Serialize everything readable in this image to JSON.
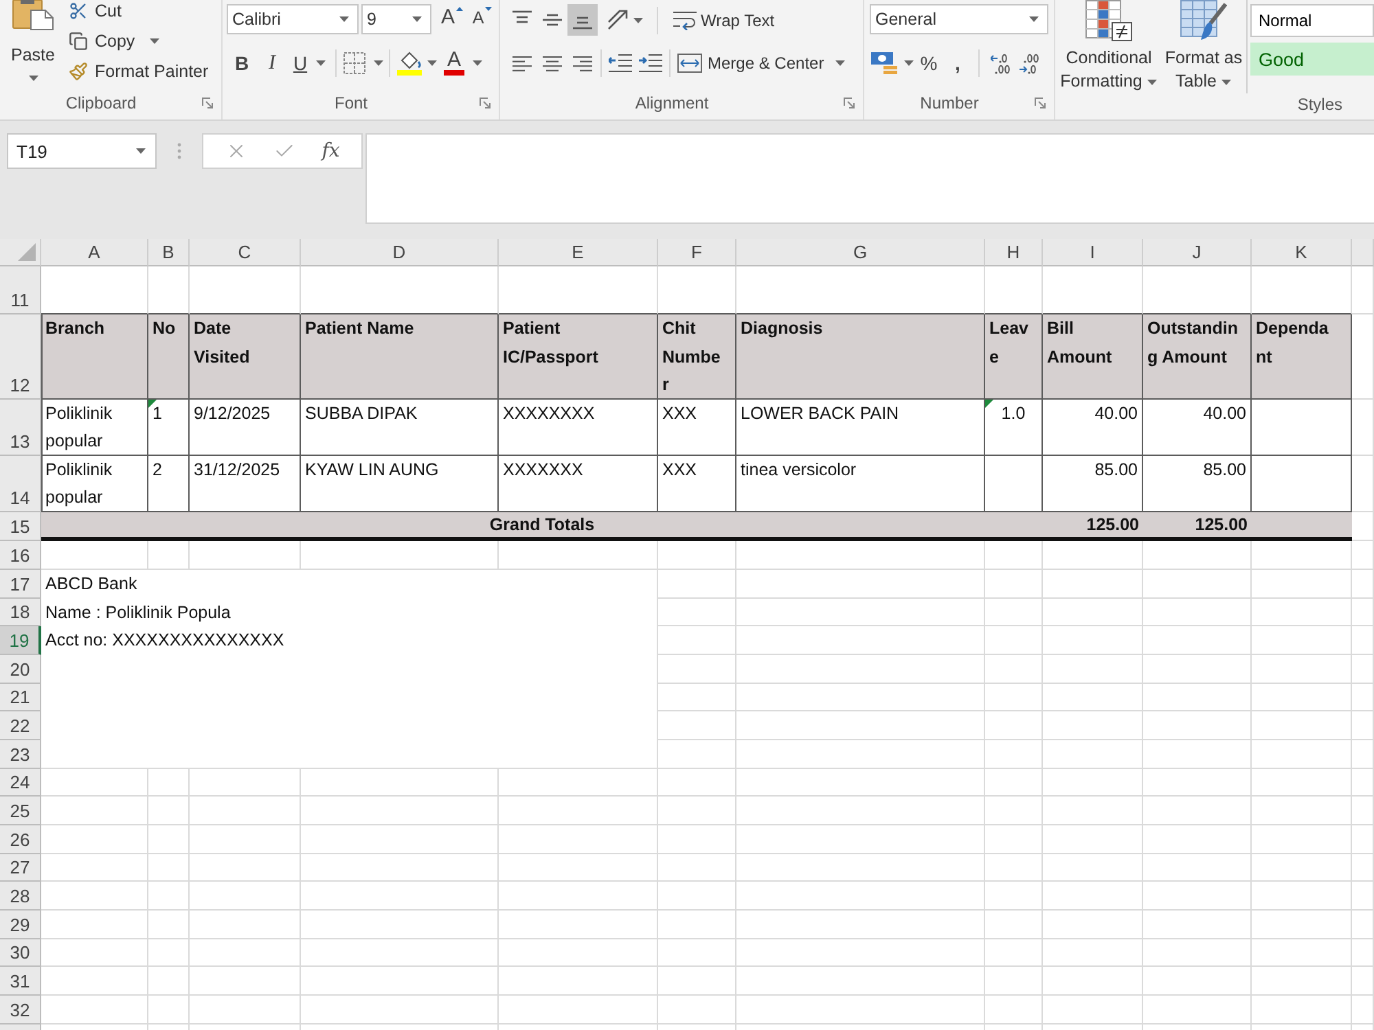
{
  "ribbon": {
    "clipboard": {
      "paste": "Paste",
      "cut": "Cut",
      "copy": "Copy",
      "format_painter": "Format Painter",
      "label": "Clipboard"
    },
    "font": {
      "font_name": "Calibri",
      "font_size": "9",
      "grow_font": "A",
      "shrink_font": "A",
      "bold": "B",
      "italic": "I",
      "underline": "U",
      "font_color": "A",
      "label": "Font"
    },
    "alignment": {
      "vertical_align": [
        {
          "kind": "top",
          "selected": false
        },
        {
          "kind": "middle",
          "selected": false
        },
        {
          "kind": "bottom",
          "selected": true
        }
      ],
      "horizontal_align": [
        {
          "kind": "left",
          "selected": false
        },
        {
          "kind": "center",
          "selected": false
        },
        {
          "kind": "right",
          "selected": false
        }
      ],
      "wrap_text": "Wrap Text",
      "merge_center": "Merge & Center",
      "label": "Alignment"
    },
    "number": {
      "format": "General",
      "percent": "%",
      "comma": ",",
      "label": "Number"
    },
    "styles": {
      "conditional_formatting": [
        "Conditional",
        "Formatting"
      ],
      "format_as_table": [
        "Format as",
        "Table"
      ],
      "cell_styles": [
        {
          "label": "Normal",
          "kind": "normal"
        },
        {
          "label": "Good",
          "kind": "good"
        }
      ],
      "label": "Styles"
    }
  },
  "formula_bar": {
    "name_box": "T19",
    "insert_function": "fx"
  },
  "sheet": {
    "columns": [
      "A",
      "B",
      "C",
      "D",
      "E",
      "F",
      "G",
      "H",
      "I",
      "J",
      "K"
    ],
    "rows": [
      {
        "label": "11",
        "selected": false,
        "kind": "blank"
      },
      {
        "label": "12",
        "selected": false,
        "kind": "header",
        "cells": [
          {
            "lines": [
              "Branch"
            ]
          },
          {
            "lines": [
              "No"
            ]
          },
          {
            "lines": [
              "Date",
              "Visited"
            ]
          },
          {
            "lines": [
              "Patient Name"
            ]
          },
          {
            "lines": [
              "Patient",
              "IC/Passport"
            ]
          },
          {
            "lines": [
              "Chit",
              "Numbe",
              "r"
            ]
          },
          {
            "lines": [
              "Diagnosis"
            ]
          },
          {
            "lines": [
              "Leav",
              "e"
            ]
          },
          {
            "lines": [
              "Bill",
              "Amount"
            ]
          },
          {
            "lines": [
              "Outstandin",
              "g Amount"
            ]
          },
          {
            "lines": [
              "Dependa",
              "nt"
            ]
          }
        ]
      },
      {
        "label": "13",
        "selected": false,
        "kind": "data",
        "cells": [
          {
            "text": "Poliklinik popular",
            "flag": false
          },
          {
            "text": "1",
            "flag": true
          },
          {
            "text": "9/12/2025",
            "flag": false
          },
          {
            "text": "SUBBA DIPAK",
            "flag": false
          },
          {
            "text": "XXXXXXXX",
            "flag": false
          },
          {
            "text": "XXX",
            "flag": false
          },
          {
            "text": "LOWER BACK PAIN",
            "flag": false
          },
          {
            "text": "1.0",
            "flag": true
          },
          {
            "text": "40.00",
            "flag": false
          },
          {
            "text": "40.00",
            "flag": false
          },
          {
            "flag": false
          }
        ]
      },
      {
        "label": "14",
        "selected": false,
        "kind": "data",
        "cells": [
          {
            "text": "Poliklinik popular",
            "flag": false
          },
          {
            "text": "2",
            "flag": false
          },
          {
            "text": "31/12/2025",
            "flag": false
          },
          {
            "text": "KYAW LIN AUNG",
            "flag": false
          },
          {
            "text": "XXXXXXX",
            "flag": false
          },
          {
            "text": "XXX",
            "flag": false
          },
          {
            "text": "tinea versicolor",
            "flag": false
          },
          {
            "flag": false
          },
          {
            "text": "85.00",
            "flag": false
          },
          {
            "text": "85.00",
            "flag": false
          },
          {
            "flag": false
          }
        ]
      },
      {
        "label": "15",
        "selected": false,
        "kind": "total",
        "cells": [
          {
            "text": "Grand Totals"
          },
          {
            "text": "125.00"
          },
          {
            "text": "125.00"
          }
        ]
      },
      {
        "label": "16",
        "selected": false,
        "kind": "blank"
      },
      {
        "label": "17",
        "selected": false,
        "kind": "note"
      },
      {
        "label": "18",
        "selected": false,
        "kind": "note"
      },
      {
        "label": "19",
        "selected": true,
        "kind": "note"
      },
      {
        "label": "20",
        "selected": false,
        "kind": "note"
      },
      {
        "label": "21",
        "selected": false,
        "kind": "note"
      },
      {
        "label": "22",
        "selected": false,
        "kind": "note"
      },
      {
        "label": "23",
        "selected": false,
        "kind": "note"
      },
      {
        "label": "24",
        "selected": false,
        "kind": "blank"
      },
      {
        "label": "25",
        "selected": false,
        "kind": "blank"
      },
      {
        "label": "26",
        "selected": false,
        "kind": "blank"
      },
      {
        "label": "27",
        "selected": false,
        "kind": "blank"
      },
      {
        "label": "28",
        "selected": false,
        "kind": "blank"
      },
      {
        "label": "29",
        "selected": false,
        "kind": "blank"
      },
      {
        "label": "30",
        "selected": false,
        "kind": "blank"
      },
      {
        "label": "31",
        "selected": false,
        "kind": "blank"
      },
      {
        "label": "32",
        "selected": false,
        "kind": "blank"
      }
    ],
    "note_lines": [
      "ABCD Bank",
      "Name : Poliklinik Popula",
      "Acct no: XXXXXXXXXXXXXXX"
    ]
  }
}
